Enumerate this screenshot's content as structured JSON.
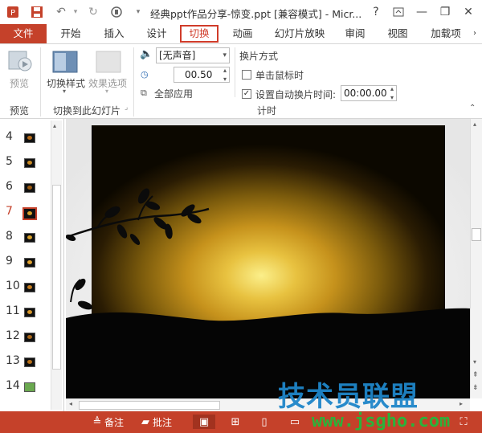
{
  "window": {
    "title": "经典ppt作品分享-惊变.ppt [兼容模式] - Micr...",
    "help": "?",
    "minimize": "—",
    "restore": "❐",
    "close": "✕"
  },
  "tabs": [
    {
      "label": "文件"
    },
    {
      "label": "开始"
    },
    {
      "label": "插入"
    },
    {
      "label": "设计"
    },
    {
      "label": "切换"
    },
    {
      "label": "动画"
    },
    {
      "label": "幻灯片放映"
    },
    {
      "label": "审阅"
    },
    {
      "label": "视图"
    },
    {
      "label": "加载项"
    }
  ],
  "ribbon": {
    "preview_label": "预览",
    "switch_style_label": "切换样式",
    "effect_options_label": "效果选项",
    "group_preview": "预览",
    "group_switch": "切换到此幻灯片",
    "sound_value": "[无声音]",
    "duration_value": "00.50",
    "apply_all_label": "全部应用",
    "advance_title": "换片方式",
    "on_click_label": "单击鼠标时",
    "auto_advance_label": "设置自动换片时间:",
    "auto_time_value": "00:00.00",
    "group_timing": "计时"
  },
  "slides": {
    "numbers": [
      "4",
      "5",
      "6",
      "7",
      "8",
      "9",
      "10",
      "11",
      "12",
      "13",
      "14"
    ],
    "selected": "7"
  },
  "status": {
    "notes_label": "备注",
    "comments_label": "批注"
  },
  "watermark": {
    "line1": "技术员联盟",
    "line2": "www.jsgho.com"
  },
  "colors": {
    "accent": "#c5412a",
    "watermark_blue": "#1f86c9",
    "watermark_green": "#2bb23a"
  }
}
